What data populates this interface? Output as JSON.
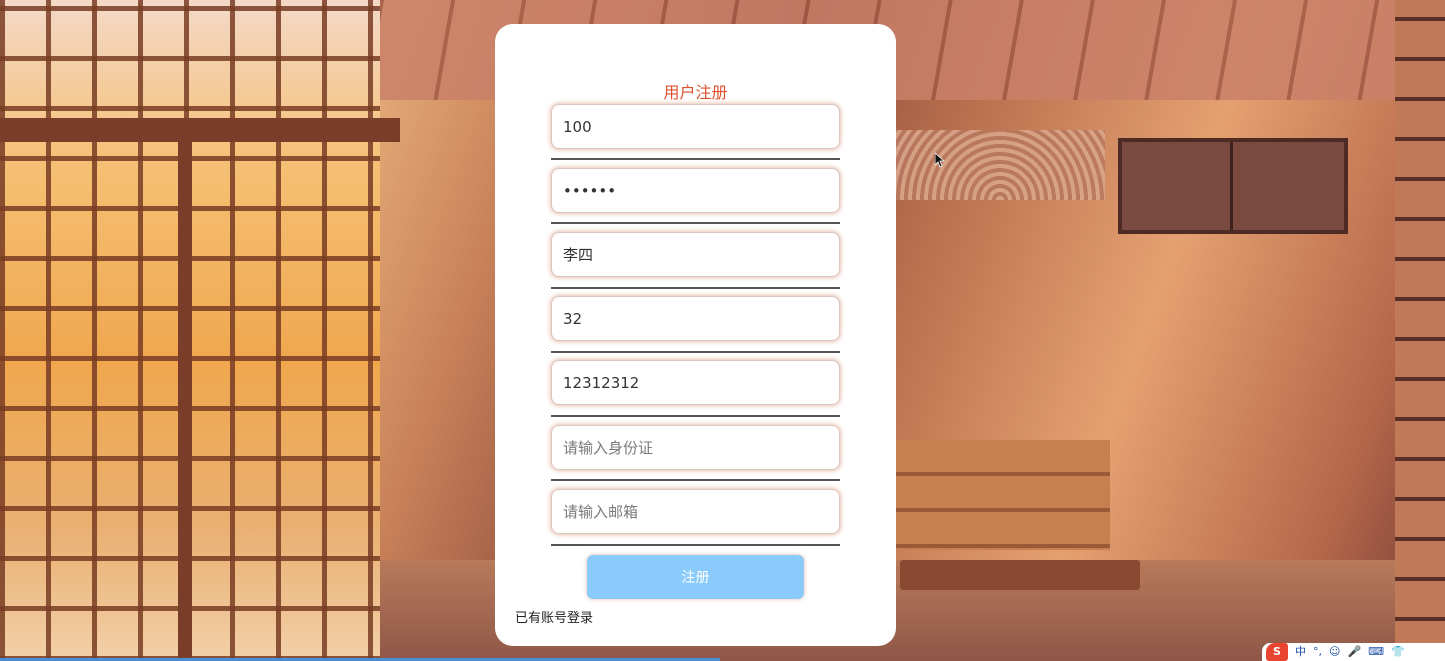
{
  "form": {
    "title": "用户注册",
    "fields": [
      {
        "name": "username",
        "type": "text",
        "value": "100",
        "placeholder": ""
      },
      {
        "name": "password",
        "type": "password",
        "value": "123456",
        "placeholder": ""
      },
      {
        "name": "realname",
        "type": "text",
        "value": "李四",
        "placeholder": ""
      },
      {
        "name": "age",
        "type": "text",
        "value": "32",
        "placeholder": ""
      },
      {
        "name": "phone",
        "type": "text",
        "value": "12312312",
        "placeholder": ""
      },
      {
        "name": "idcard",
        "type": "text",
        "value": "",
        "placeholder": "请输入身份证"
      },
      {
        "name": "email",
        "type": "text",
        "value": "",
        "placeholder": "请输入邮箱"
      }
    ],
    "submit_label": "注册",
    "login_link": "已有账号登录"
  },
  "ime_tray": {
    "logo": "S",
    "items": [
      "中",
      "°,",
      "☺",
      "🎤",
      "⌨",
      "👕"
    ]
  },
  "colors": {
    "title": "#e0522d",
    "submit_bg": "#8acbfb",
    "card_bg": "#ffffff"
  }
}
